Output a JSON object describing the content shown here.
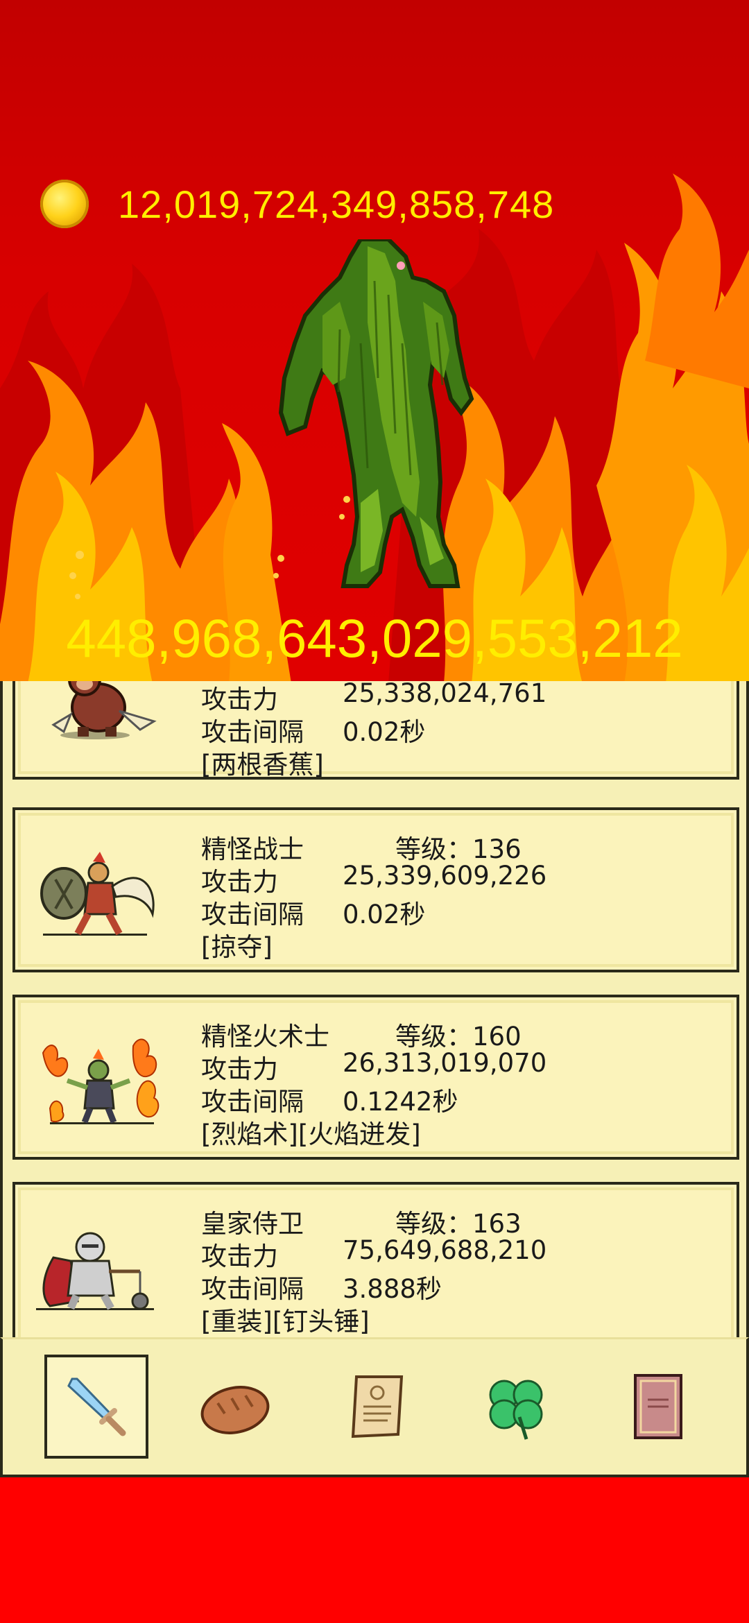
{
  "header": {
    "gold_amount": "12,019,724,349,858,748",
    "monster_hp": "448,968,643,029,553,212",
    "coin_icon": "gold-coin-icon",
    "monster_icon": "swamp-monster-icon"
  },
  "units": [
    {
      "name": "",
      "level": "",
      "attack_label": "攻击力",
      "attack_value": "25,338,024,761",
      "interval_label": "攻击间隔",
      "interval_value": "0.02秒",
      "skills": "[两根香蕉]",
      "portrait": "monkey-icon"
    },
    {
      "name": "精怪战士",
      "level": "等级：136",
      "attack_label": "攻击力",
      "attack_value": "25,339,609,226",
      "interval_label": "攻击间隔",
      "interval_value": "0.02秒",
      "skills": "[掠夺]",
      "portrait": "goblin-warrior-icon"
    },
    {
      "name": "精怪火术士",
      "level": "等级：160",
      "attack_label": "攻击力",
      "attack_value": "26,313,019,070",
      "interval_label": "攻击间隔",
      "interval_value": "0.1242秒",
      "skills": "[烈焰术][火焰迸发]",
      "portrait": "goblin-pyromancer-icon"
    },
    {
      "name": "皇家侍卫",
      "level": "等级：163",
      "attack_label": "攻击力",
      "attack_value": "75,649,688,210",
      "interval_label": "攻击间隔",
      "interval_value": "3.888秒",
      "skills": "[重装][钉头锤]",
      "portrait": "royal-guard-icon"
    }
  ],
  "tabs": [
    {
      "icon": "sword-icon",
      "active": true
    },
    {
      "icon": "bread-icon",
      "active": false
    },
    {
      "icon": "scroll-icon",
      "active": false
    },
    {
      "icon": "clover-icon",
      "active": false
    },
    {
      "icon": "book-icon",
      "active": false
    }
  ],
  "colors": {
    "fire_red": "#e00000",
    "gold_text": "#ffee00",
    "panel_bg": "#f6f0b6",
    "bottom_bg": "#ff0000"
  }
}
